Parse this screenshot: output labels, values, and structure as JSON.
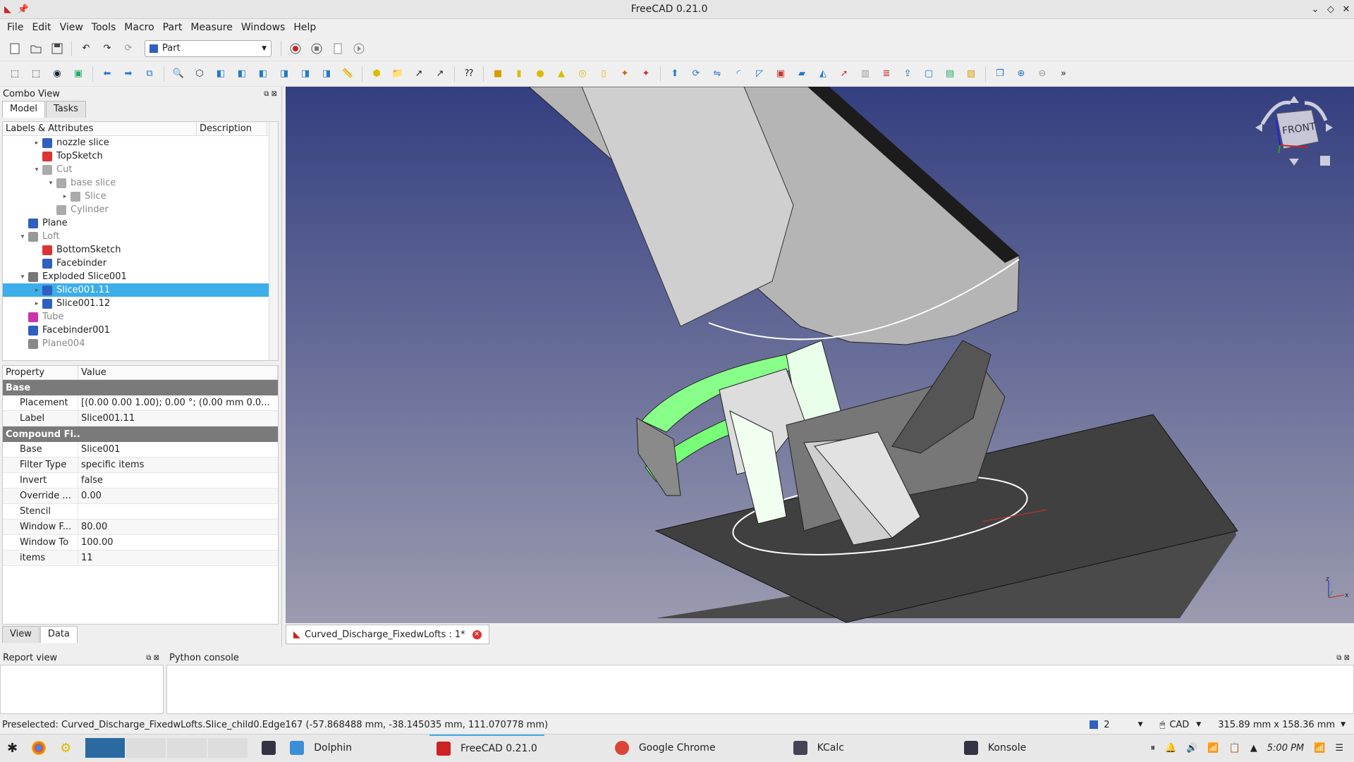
{
  "window": {
    "title": "FreeCAD 0.21.0"
  },
  "menu": [
    "File",
    "Edit",
    "View",
    "Tools",
    "Macro",
    "Part",
    "Measure",
    "Windows",
    "Help"
  ],
  "toolbar": {
    "workbench": "Part"
  },
  "combo": {
    "title": "Combo View",
    "tabs": [
      "Model",
      "Tasks"
    ],
    "tree_headers": [
      "Labels & Attributes",
      "Description"
    ],
    "tree": [
      {
        "label": "nozzle slice",
        "level": 2,
        "exp": "▸",
        "icon": "solid-icon",
        "color": "#2f5fbf",
        "state": "normal"
      },
      {
        "label": "TopSketch",
        "level": 2,
        "exp": "",
        "icon": "sketch-icon",
        "color": "#d33",
        "state": "normal"
      },
      {
        "label": "Cut",
        "level": 2,
        "exp": "▾",
        "icon": "cut-icon",
        "color": "#aaa",
        "state": "dim"
      },
      {
        "label": "base slice",
        "level": 3,
        "exp": "▾",
        "icon": "solid-icon",
        "color": "#aaa",
        "state": "dim"
      },
      {
        "label": "Slice",
        "level": 4,
        "exp": "▸",
        "icon": "solid-icon",
        "color": "#aaa",
        "state": "dim"
      },
      {
        "label": "Cylinder",
        "level": 3,
        "exp": "",
        "icon": "cylinder-icon",
        "color": "#aaa",
        "state": "dim"
      },
      {
        "label": "Plane",
        "level": 1,
        "exp": "",
        "icon": "plane-icon",
        "color": "#2f5fbf",
        "state": "normal"
      },
      {
        "label": "Loft",
        "level": 1,
        "exp": "▾",
        "icon": "loft-icon",
        "color": "#999",
        "state": "dim"
      },
      {
        "label": "BottomSketch",
        "level": 2,
        "exp": "",
        "icon": "sketch-icon",
        "color": "#d33",
        "state": "normal"
      },
      {
        "label": "Facebinder",
        "level": 2,
        "exp": "",
        "icon": "facebinder-icon",
        "color": "#2f5fbf",
        "state": "normal"
      },
      {
        "label": "Exploded Slice001",
        "level": 1,
        "exp": "▾",
        "icon": "folder-icon",
        "color": "#777",
        "state": "normal"
      },
      {
        "label": "Slice001.11",
        "level": 2,
        "exp": "▸",
        "icon": "solid-icon",
        "color": "#2f5fbf",
        "state": "sel"
      },
      {
        "label": "Slice001.12",
        "level": 2,
        "exp": "▸",
        "icon": "solid-icon",
        "color": "#2f5fbf",
        "state": "normal"
      },
      {
        "label": "Tube",
        "level": 1,
        "exp": "",
        "icon": "tube-icon",
        "color": "#c3a",
        "state": "dim"
      },
      {
        "label": "Facebinder001",
        "level": 1,
        "exp": "",
        "icon": "facebinder-icon",
        "color": "#2f5fbf",
        "state": "normal"
      },
      {
        "label": "Plane004",
        "level": 1,
        "exp": "",
        "icon": "plane-icon",
        "color": "#888",
        "state": "dim"
      }
    ],
    "prop_headers": [
      "Property",
      "Value"
    ],
    "groups": [
      {
        "name": "Base",
        "rows": [
          {
            "k": "Placement",
            "v": "[(0.00 0.00 1.00); 0.00 °; (0.00 mm  0.0..."
          },
          {
            "k": "Label",
            "v": "Slice001.11"
          }
        ]
      },
      {
        "name": "Compound Fi..",
        "rows": [
          {
            "k": "Base",
            "v": "Slice001"
          },
          {
            "k": "Filter Type",
            "v": "specific items"
          },
          {
            "k": "Invert",
            "v": "false"
          },
          {
            "k": "Override ...",
            "v": "0.00"
          },
          {
            "k": "Stencil",
            "v": ""
          },
          {
            "k": "Window F...",
            "v": "80.00"
          },
          {
            "k": "Window To",
            "v": "100.00"
          },
          {
            "k": "items",
            "v": "11"
          }
        ]
      }
    ],
    "bottom_tabs": [
      "View",
      "Data"
    ]
  },
  "doc_tab": "Curved_Discharge_FixedwLofts : 1*",
  "navcube": "FRONT",
  "report": {
    "title": "Report view"
  },
  "python": {
    "title": "Python console"
  },
  "status": {
    "message": "Preselected: Curved_Discharge_FixedwLofts.Slice_child0.Edge167 (-57.868488 mm, -38.145035 mm, 111.070778 mm)",
    "count": "2",
    "nav": "CAD",
    "dims": "315.89 mm x 158.36 mm"
  },
  "taskbar": {
    "tasks": [
      "Dolphin",
      "FreeCAD 0.21.0",
      "Google Chrome",
      "KCalc",
      "Konsole"
    ],
    "clock": "5:00 PM"
  }
}
